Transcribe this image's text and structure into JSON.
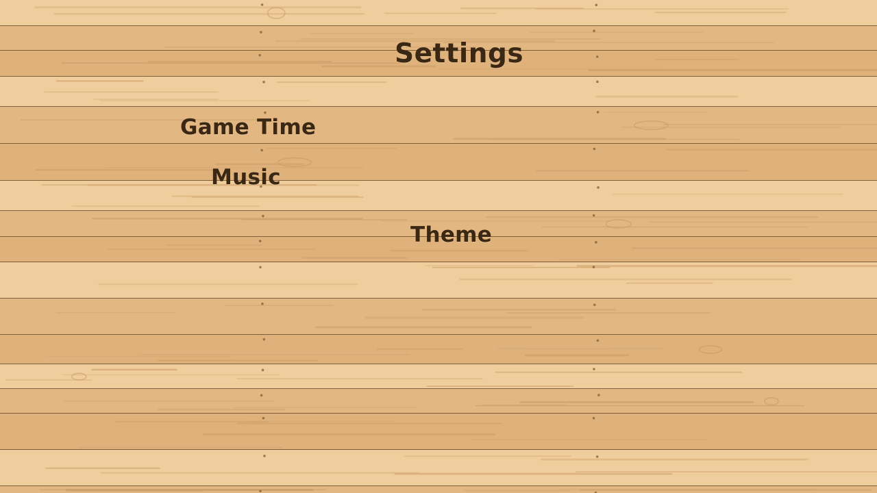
{
  "screen": {
    "title": "Settings"
  },
  "menu": {
    "items": [
      {
        "label": "Game Time"
      },
      {
        "label": "Music"
      },
      {
        "label": "Theme"
      }
    ]
  },
  "background": {
    "texture": "wooden-planks",
    "base_color": "#e3b782",
    "light_color": "#efcd9c",
    "dark_color": "#c99a63",
    "seam_color": "#5e3f20",
    "text_color": "#3a2714"
  }
}
